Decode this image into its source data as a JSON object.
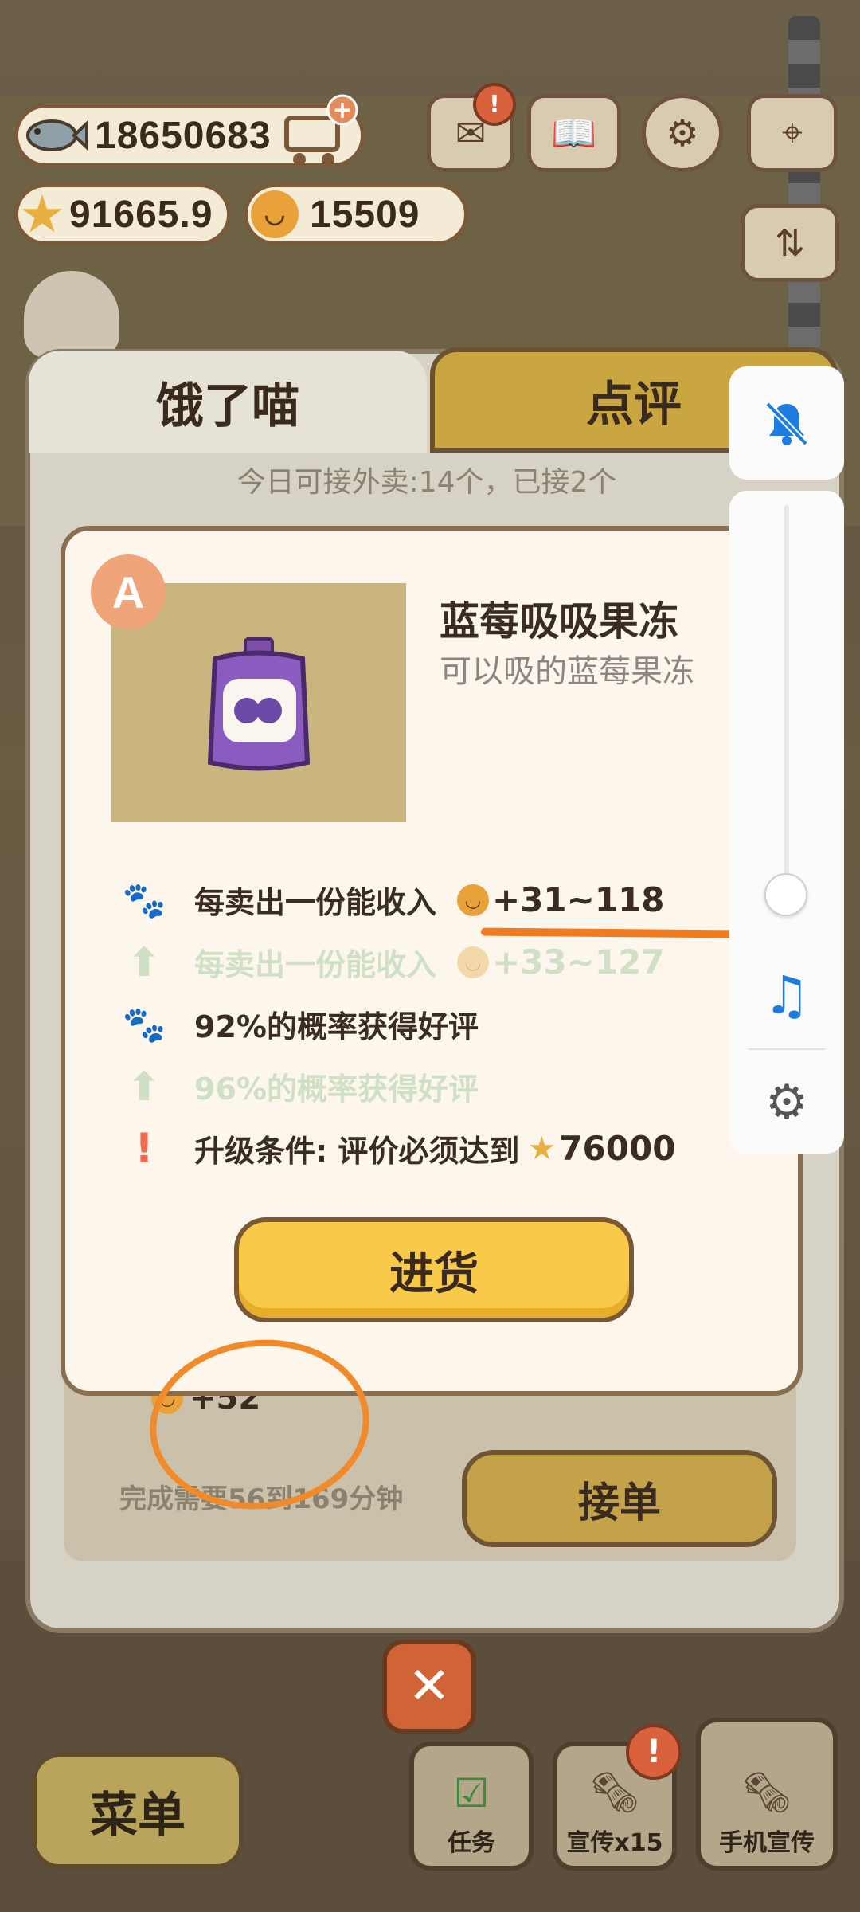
{
  "currencies": {
    "fish": "18650683",
    "stars": "91665.9",
    "bells": "15509"
  },
  "top_icons": [
    "fish-icon",
    "cart-plus-icon",
    "star-icon",
    "bell-coin-icon",
    "mail-icon",
    "book-icon",
    "gear-icon",
    "map-icon",
    "sliders-icon"
  ],
  "tabs": {
    "active": "饿了喵",
    "inactive": "点评"
  },
  "daily_info": "今日可接外卖:14个，已接2个",
  "item": {
    "grade": "A",
    "name": "蓝莓吸吸果冻",
    "description": "可以吸的蓝莓果冻"
  },
  "stats": [
    {
      "icon": "paw-icon",
      "text": "每卖出一份能收入",
      "value": "+31~118",
      "style": "dark",
      "currency": "bell"
    },
    {
      "icon": "up-arrow-icon",
      "text": "每卖出一份能收入",
      "value": "+33~127",
      "style": "faded",
      "currency": "bell"
    },
    {
      "icon": "paw-icon",
      "text": "92%的概率获得好评",
      "value": "",
      "style": "dark",
      "currency": ""
    },
    {
      "icon": "up-arrow-icon",
      "text": "96%的概率获得好评",
      "value": "",
      "style": "faded",
      "currency": ""
    },
    {
      "icon": "exclamation-icon",
      "text": "升级条件: 评价必须达到",
      "value": "76000",
      "style": "dark",
      "currency": "star"
    }
  ],
  "stock_button": "进货",
  "order": {
    "reward": "+52",
    "complete_text": "完成需要56到169分钟",
    "accept_button": "接单"
  },
  "bottom": {
    "menu": "菜单",
    "tasks": "任务",
    "promo": "宣传x15",
    "phone_promo": "手机宣传",
    "promo_alert": "!"
  },
  "system_overlay": {
    "icons": [
      "bell-muted-icon",
      "music-note-icon",
      "settings-gear-icon"
    ],
    "volume_level": 0.1
  },
  "colors": {
    "accent_orange": "#f27a1f",
    "button_yellow": "#f9c94a",
    "muted_bell_blue": "#1e7be0"
  }
}
